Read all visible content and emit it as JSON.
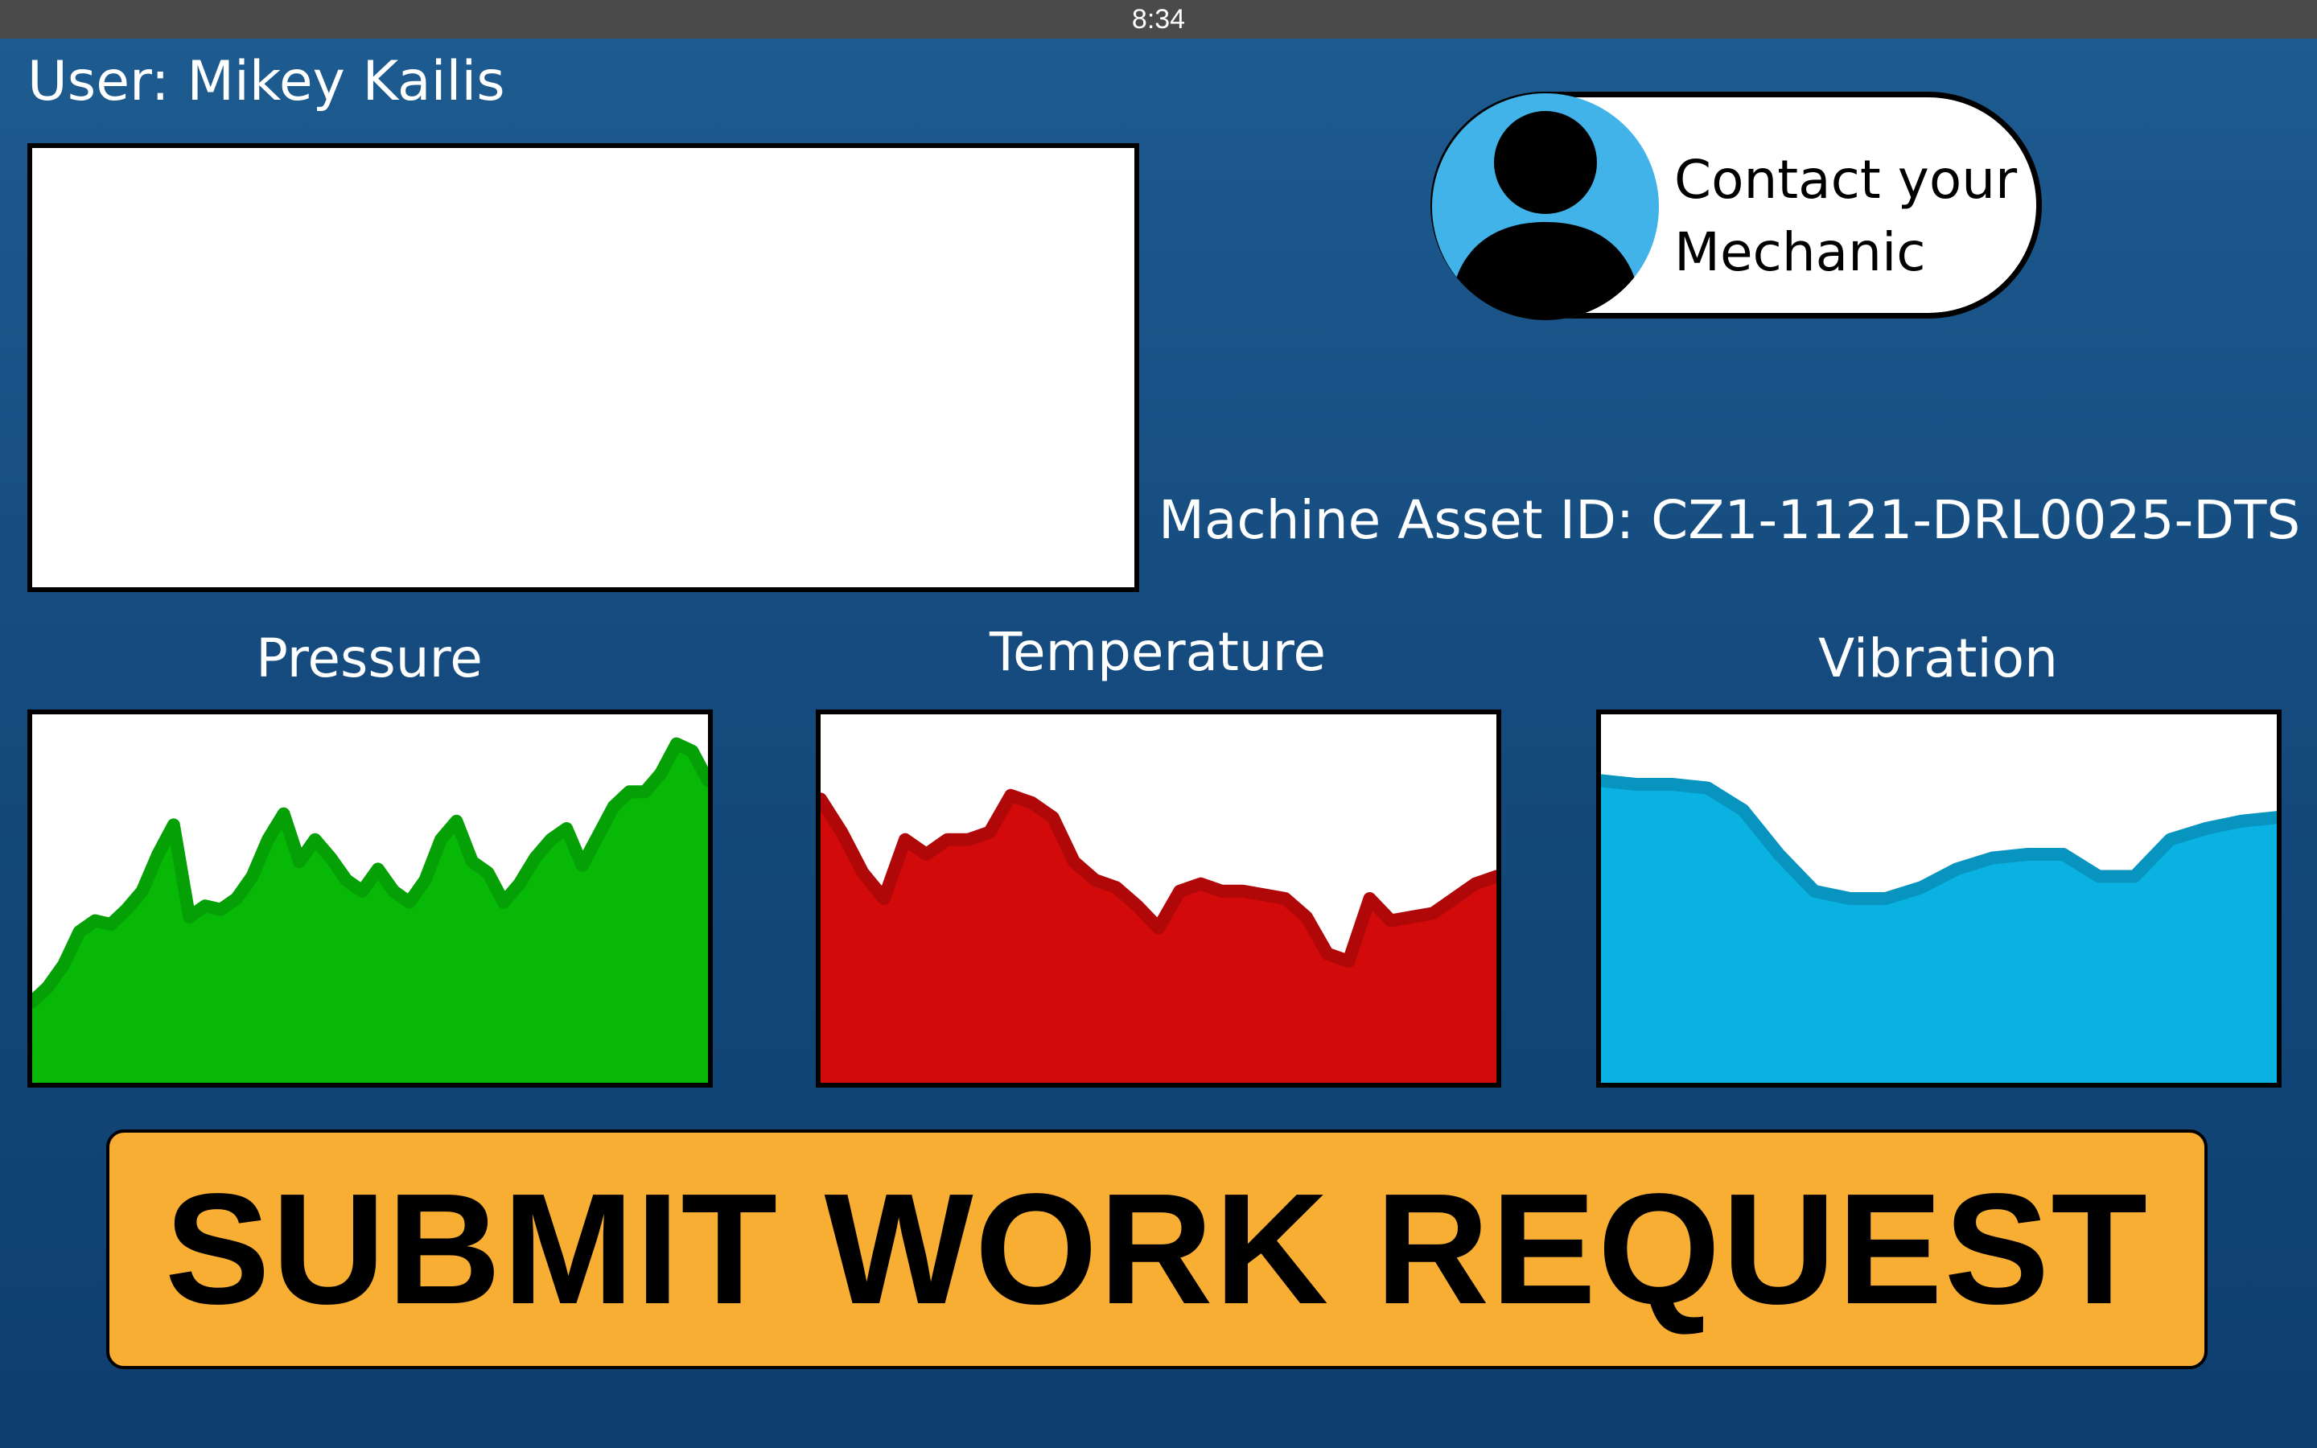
{
  "status_bar": {
    "time": "8:34"
  },
  "user": {
    "label": "User: Mikey Kailis"
  },
  "contact": {
    "line1": "Contact your",
    "line2": "Mechanic",
    "avatar_icon": "person-icon",
    "avatar_bg": "#41b3e8"
  },
  "machine": {
    "asset_label": "Machine Asset ID: CZ1-1121-DRL0025-DTS"
  },
  "chart_data": [
    {
      "type": "area",
      "title": "Pressure",
      "color": "#07b807",
      "stroke": "#05a005",
      "ylim": [
        0,
        100
      ],
      "values": [
        22,
        26,
        32,
        41,
        44,
        43,
        47,
        52,
        62,
        70,
        45,
        48,
        47,
        50,
        56,
        66,
        73,
        60,
        66,
        61,
        55,
        52,
        58,
        52,
        49,
        55,
        66,
        71,
        60,
        57,
        49,
        54,
        61,
        66,
        69,
        59,
        67,
        75,
        79,
        79,
        84,
        92,
        90,
        82
      ]
    },
    {
      "type": "area",
      "title": "Temperature",
      "color": "#d20a0a",
      "stroke": "#b00808",
      "ylim": [
        0,
        100
      ],
      "values": [
        77,
        68,
        57,
        50,
        66,
        62,
        66,
        66,
        68,
        78,
        76,
        72,
        60,
        55,
        53,
        48,
        42,
        52,
        54,
        52,
        52,
        51,
        50,
        45,
        35,
        33,
        50,
        44,
        45,
        46,
        50,
        54,
        56
      ]
    },
    {
      "type": "area",
      "title": "Vibration",
      "color": "#0ab2e2",
      "stroke": "#0795c0",
      "ylim": [
        0,
        100
      ],
      "values": [
        82,
        81,
        81,
        80,
        74,
        62,
        52,
        50,
        50,
        53,
        58,
        61,
        62,
        62,
        56,
        56,
        66,
        69,
        71,
        72
      ]
    }
  ],
  "actions": {
    "submit_label": "SUBMIT WORK REQUEST"
  }
}
